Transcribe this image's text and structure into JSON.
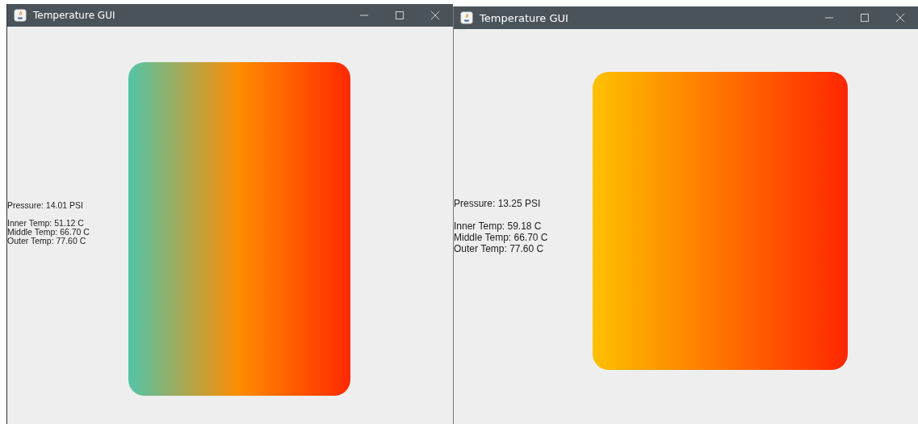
{
  "windows": [
    {
      "title": "Temperature GUI",
      "pressure": "Pressure: 14.01 PSI",
      "temperatures": [
        "Inner Temp: 51.12 C",
        "Middle Temp: 66.70 C",
        "Outer Temp: 77.60 C"
      ],
      "gradient": [
        {
          "color": "#52c4a8"
        },
        {
          "color": "#ff8c00"
        },
        {
          "color": "#ff2800"
        }
      ]
    },
    {
      "title": "Temperature GUI",
      "pressure": "Pressure: 13.25 PSI",
      "temperatures": [
        "Inner Temp: 59.18 C",
        "Middle Temp: 66.70 C",
        "Outer Temp: 77.60 C"
      ],
      "gradient": [
        {
          "color": "#ffc000"
        },
        {
          "color": "#ff2600"
        }
      ]
    }
  ]
}
